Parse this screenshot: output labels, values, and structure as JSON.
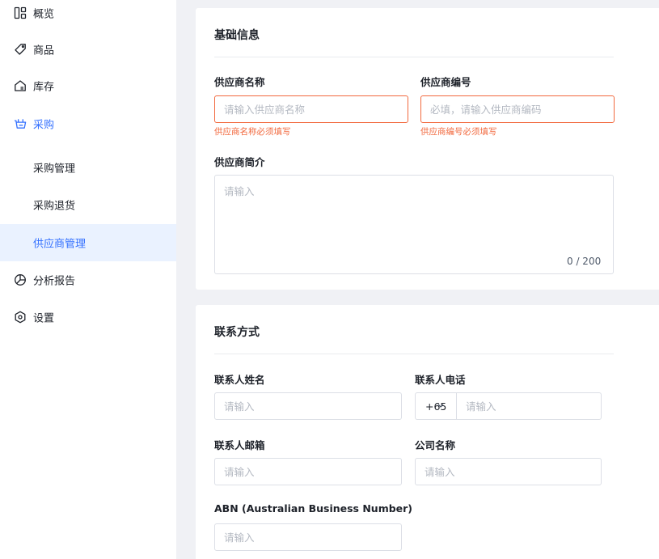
{
  "sidebar": {
    "items": [
      {
        "label": "概览",
        "icon": "dashboard-icon"
      },
      {
        "label": "商品",
        "icon": "tag-icon"
      },
      {
        "label": "库存",
        "icon": "warehouse-icon"
      },
      {
        "label": "采购",
        "icon": "basket-icon"
      },
      {
        "label": "采购管理"
      },
      {
        "label": "采购退货"
      },
      {
        "label": "供应商管理"
      },
      {
        "label": "分析报告",
        "icon": "pie-chart-icon"
      },
      {
        "label": "设置",
        "icon": "settings-icon"
      }
    ],
    "accent_color": "#3370ff"
  },
  "basic_info": {
    "title": "基础信息",
    "supplier_name": {
      "label": "供应商名称",
      "placeholder": "请输入供应商名称",
      "error": "供应商名称必须填写"
    },
    "supplier_code": {
      "label": "供应商编号",
      "placeholder": "必填，请输入供应商编码",
      "error": "供应商编号必须填写"
    },
    "supplier_intro": {
      "label": "供应商简介",
      "placeholder": "请输入",
      "counter": "0 / 200"
    }
  },
  "contact": {
    "title": "联系方式",
    "contact_name": {
      "label": "联系人姓名",
      "placeholder": "请输入"
    },
    "contact_phone": {
      "label": "联系人电话",
      "code": "+65",
      "placeholder": "请输入"
    },
    "contact_email": {
      "label": "联系人邮箱",
      "placeholder": "请输入"
    },
    "company_name": {
      "label": "公司名称",
      "placeholder": "请输入"
    },
    "abn": {
      "label": "ABN (Australian Business Number)",
      "placeholder": "请输入"
    }
  },
  "colors": {
    "error": "#f2693e",
    "accent": "#3370ff"
  }
}
